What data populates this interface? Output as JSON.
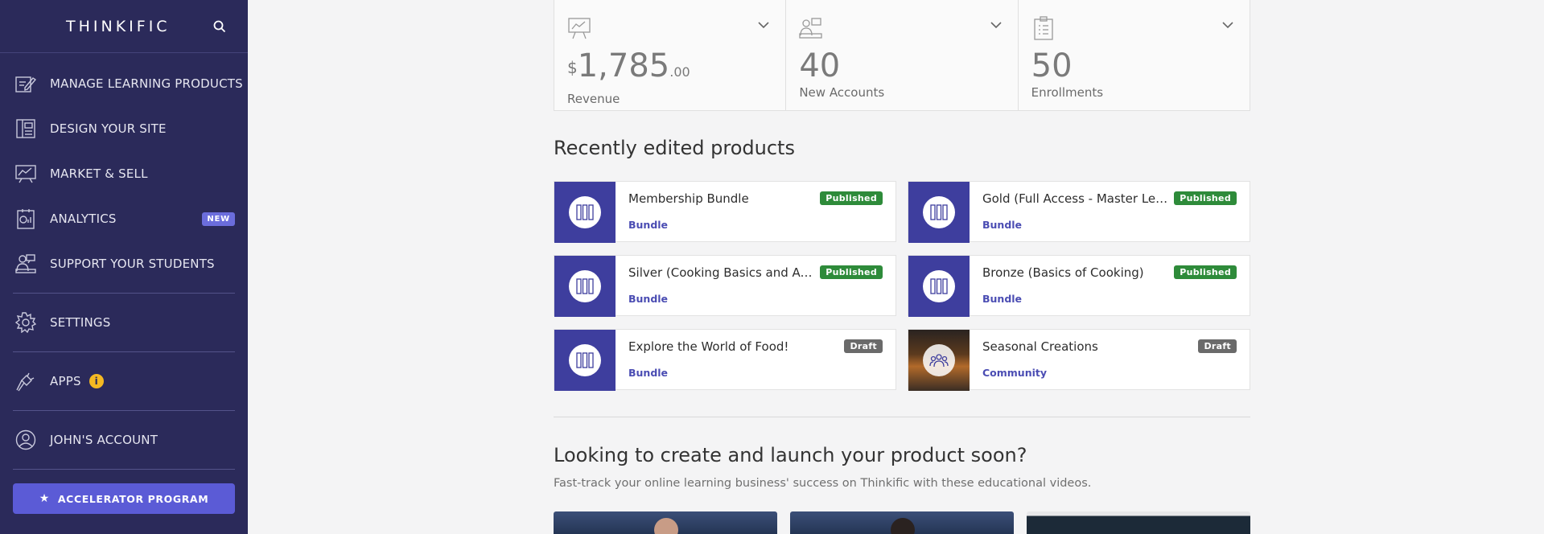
{
  "brand": {
    "name": "THINKIFIC"
  },
  "sidebar": {
    "items": [
      {
        "label": "MANAGE LEARNING PRODUCTS",
        "icon": "edit-doc-icon"
      },
      {
        "label": "DESIGN YOUR SITE",
        "icon": "layout-icon"
      },
      {
        "label": "MARKET & SELL",
        "icon": "chart-board-icon"
      },
      {
        "label": "ANALYTICS",
        "icon": "analytics-icon",
        "badge": "NEW"
      },
      {
        "label": "SUPPORT YOUR STUDENTS",
        "icon": "students-icon"
      },
      {
        "label": "SETTINGS",
        "icon": "gear-icon"
      },
      {
        "label": "APPS",
        "icon": "plug-icon",
        "info": "i"
      },
      {
        "label": "JOHN'S ACCOUNT",
        "icon": "user-icon"
      }
    ],
    "accelerator": "ACCELERATOR PROGRAM"
  },
  "stats": [
    {
      "currency": "$",
      "value": "1,785",
      "cents": ".00",
      "label": "Revenue"
    },
    {
      "value": "40",
      "label": "New Accounts"
    },
    {
      "value": "50",
      "label": "Enrollments"
    }
  ],
  "recent": {
    "title": "Recently edited products",
    "products": [
      {
        "name": "Membership Bundle",
        "type": "Bundle",
        "status": "Published"
      },
      {
        "name": "Gold (Full Access - Master Lev...",
        "type": "Bundle",
        "status": "Published"
      },
      {
        "name": "Silver (Cooking Basics and Ad...",
        "type": "Bundle",
        "status": "Published"
      },
      {
        "name": "Bronze (Basics of Cooking)",
        "type": "Bundle",
        "status": "Published"
      },
      {
        "name": "Explore the World of Food!",
        "type": "Bundle",
        "status": "Draft"
      },
      {
        "name": "Seasonal Creations",
        "type": "Community",
        "status": "Draft"
      }
    ]
  },
  "launch": {
    "title": "Looking to create and launch your product soon?",
    "subtitle": "Fast-track your online learning business' success on Thinkific with these educational videos."
  },
  "colors": {
    "sidebar_bg": "#2b2a5a",
    "accent": "#5b5bd6",
    "published": "#2e8b3a",
    "draft": "#6a6a6a",
    "product_thumb": "#3e3e9e"
  }
}
